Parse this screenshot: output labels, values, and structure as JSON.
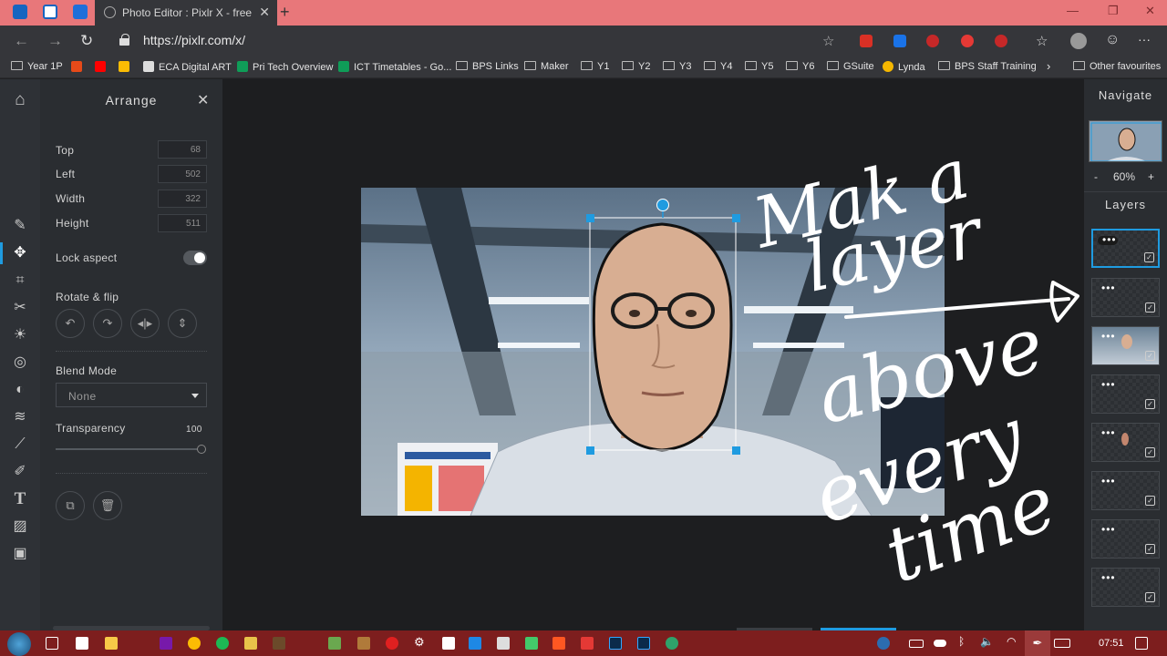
{
  "browser": {
    "tab_title": "Photo Editor : Pixlr X - free image editing online",
    "url": "https://pixlr.com/x/",
    "bookmarks": [
      "Year 1P",
      "ECA Digital ART",
      "Pri Tech Overview",
      "ICT Timetables - Go...",
      "BPS Links",
      "Maker",
      "Y1",
      "Y2",
      "Y3",
      "Y4",
      "Y5",
      "Y6",
      "GSuite",
      "Lynda",
      "BPS Staff Training",
      "Other favourites"
    ],
    "extension_badges": [
      "ABP",
      "1",
      "2"
    ]
  },
  "arrange_panel": {
    "title": "Arrange",
    "top_label": "Top",
    "top_value": "68",
    "left_label": "Left",
    "left_value": "502",
    "width_label": "Width",
    "width_value": "322",
    "height_label": "Height",
    "height_value": "511",
    "lock_aspect_label": "Lock aspect",
    "lock_aspect_on": true,
    "rotate_flip_label": "Rotate & flip",
    "blend_mode_label": "Blend Mode",
    "blend_mode_value": "None",
    "transparency_label": "Transparency",
    "transparency_value": "100"
  },
  "navigate_panel": {
    "title": "Navigate",
    "zoom_minus": "-",
    "zoom_value": "60%",
    "zoom_plus": "+"
  },
  "layers_panel": {
    "title": "Layers",
    "layer_count": 8,
    "selected_index": 0
  },
  "annotation": {
    "line1": "Mak a",
    "line2": "layer",
    "line3": "above",
    "line4": "every",
    "line5": "time"
  },
  "taskbar": {
    "time": "07:51"
  },
  "colors": {
    "accent": "#1f9be0",
    "tab_strip": "#e8777a",
    "taskbar": "#7d1e1e"
  }
}
